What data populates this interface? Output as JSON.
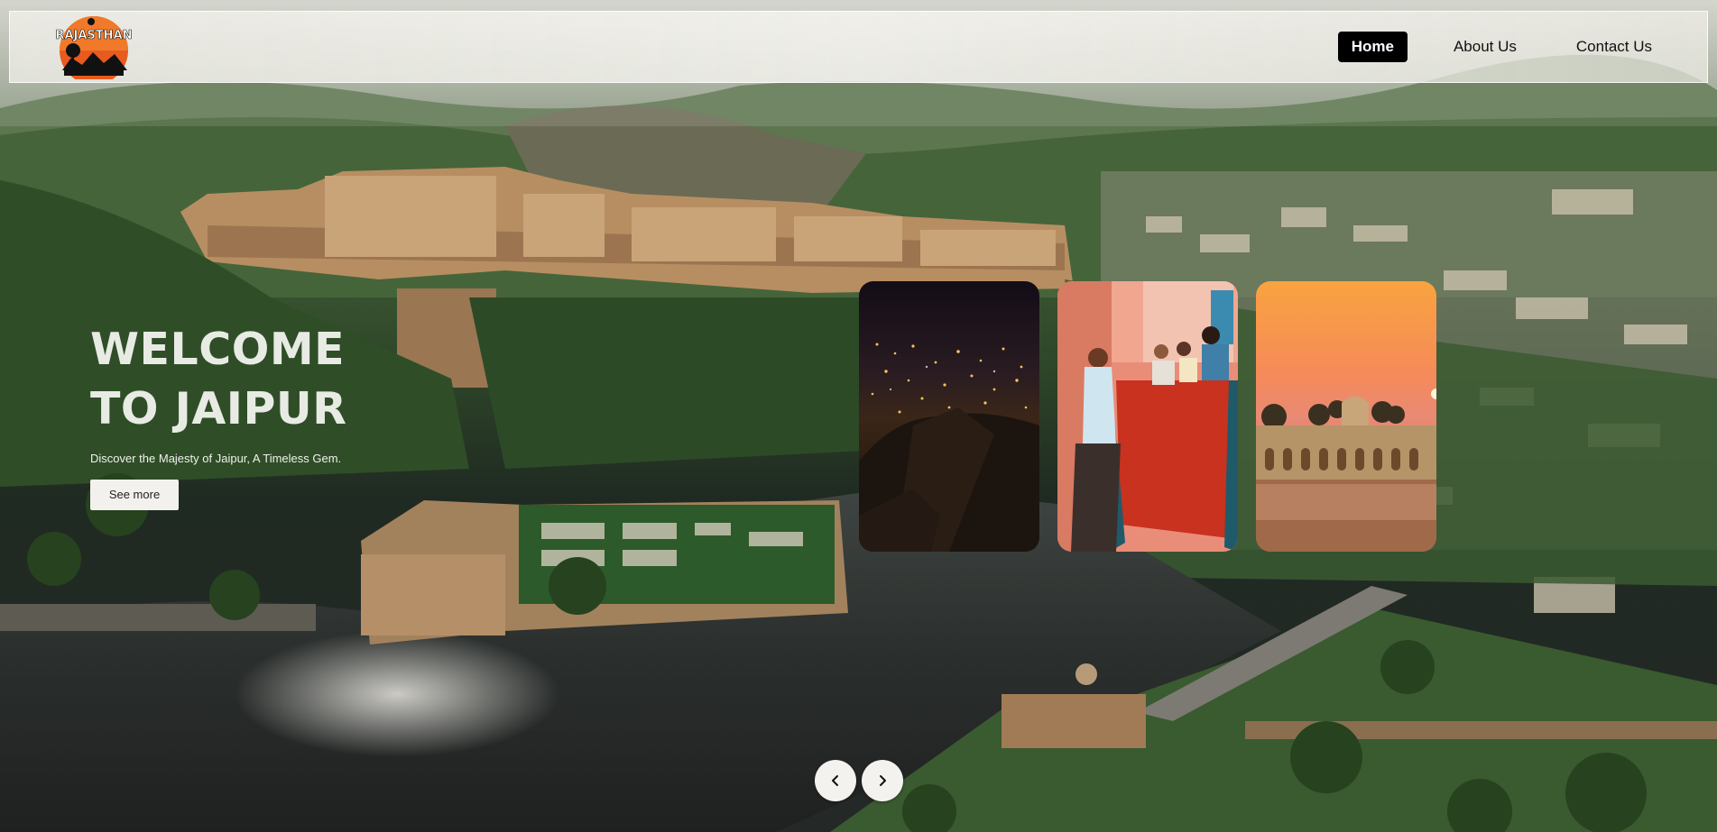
{
  "brand": {
    "logo_text": "RAJASTHAN",
    "logo_icon": "sunset-landscape-logo"
  },
  "nav": {
    "items": [
      {
        "label": "Home",
        "active": true
      },
      {
        "label": "About Us",
        "active": false
      },
      {
        "label": "Contact Us",
        "active": false
      }
    ]
  },
  "hero": {
    "title_line1": "WELCOME",
    "title_line2": "TO JAIPUR",
    "subtitle": "Discover the Majesty of Jaipur, A Timeless Gem.",
    "cta_label": "See more"
  },
  "cards": [
    {
      "name": "night-city-card",
      "theme": "night city lights"
    },
    {
      "name": "street-people-card",
      "theme": "people in red pink street"
    },
    {
      "name": "water-palace-card",
      "theme": "palace at sunset"
    }
  ],
  "controls": {
    "prev_icon": "chevron-left-icon",
    "next_icon": "chevron-right-icon",
    "prev_glyph": "‹",
    "next_glyph": "›"
  },
  "colors": {
    "active_nav_bg": "#000000",
    "logo_sun": "#e85b1e",
    "button_bg": "#f3f1ee"
  }
}
